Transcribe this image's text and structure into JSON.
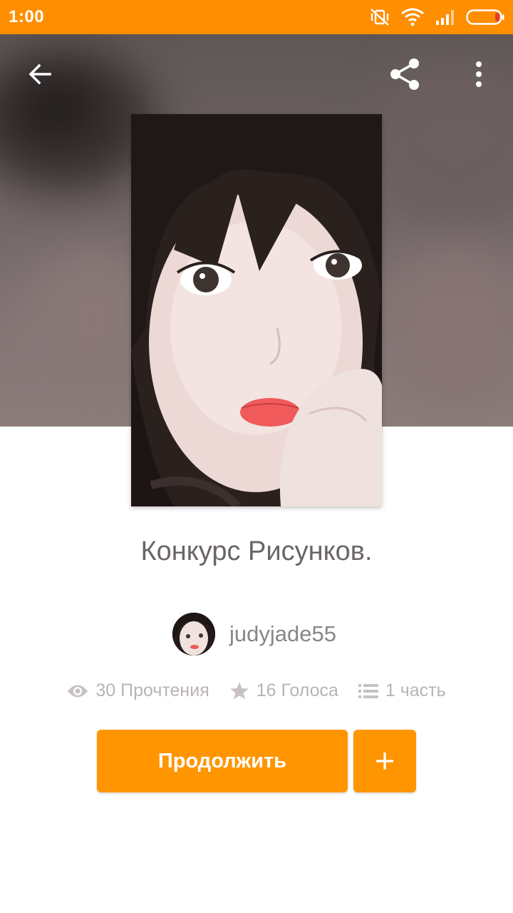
{
  "status_bar": {
    "time": "1:00",
    "icons": [
      "vibrate-off-icon",
      "wifi-icon",
      "signal-icon",
      "battery-icon"
    ]
  },
  "toolbar": {
    "back_icon": "arrow-left-icon",
    "share_icon": "share-icon",
    "menu_icon": "more-vertical-icon"
  },
  "story": {
    "title": "Конкурс Рисунков.",
    "author": "judyjade55",
    "stats": {
      "reads": "30 Прочтения",
      "votes": "16 Голоса",
      "parts": "1 часть"
    }
  },
  "actions": {
    "continue_label": "Продолжить",
    "add_icon": "plus-icon"
  },
  "colors": {
    "accent": "#ff9500",
    "status_bar": "#ff8e00",
    "title_text": "#6b6566",
    "meta_text": "#b9b3b4"
  }
}
